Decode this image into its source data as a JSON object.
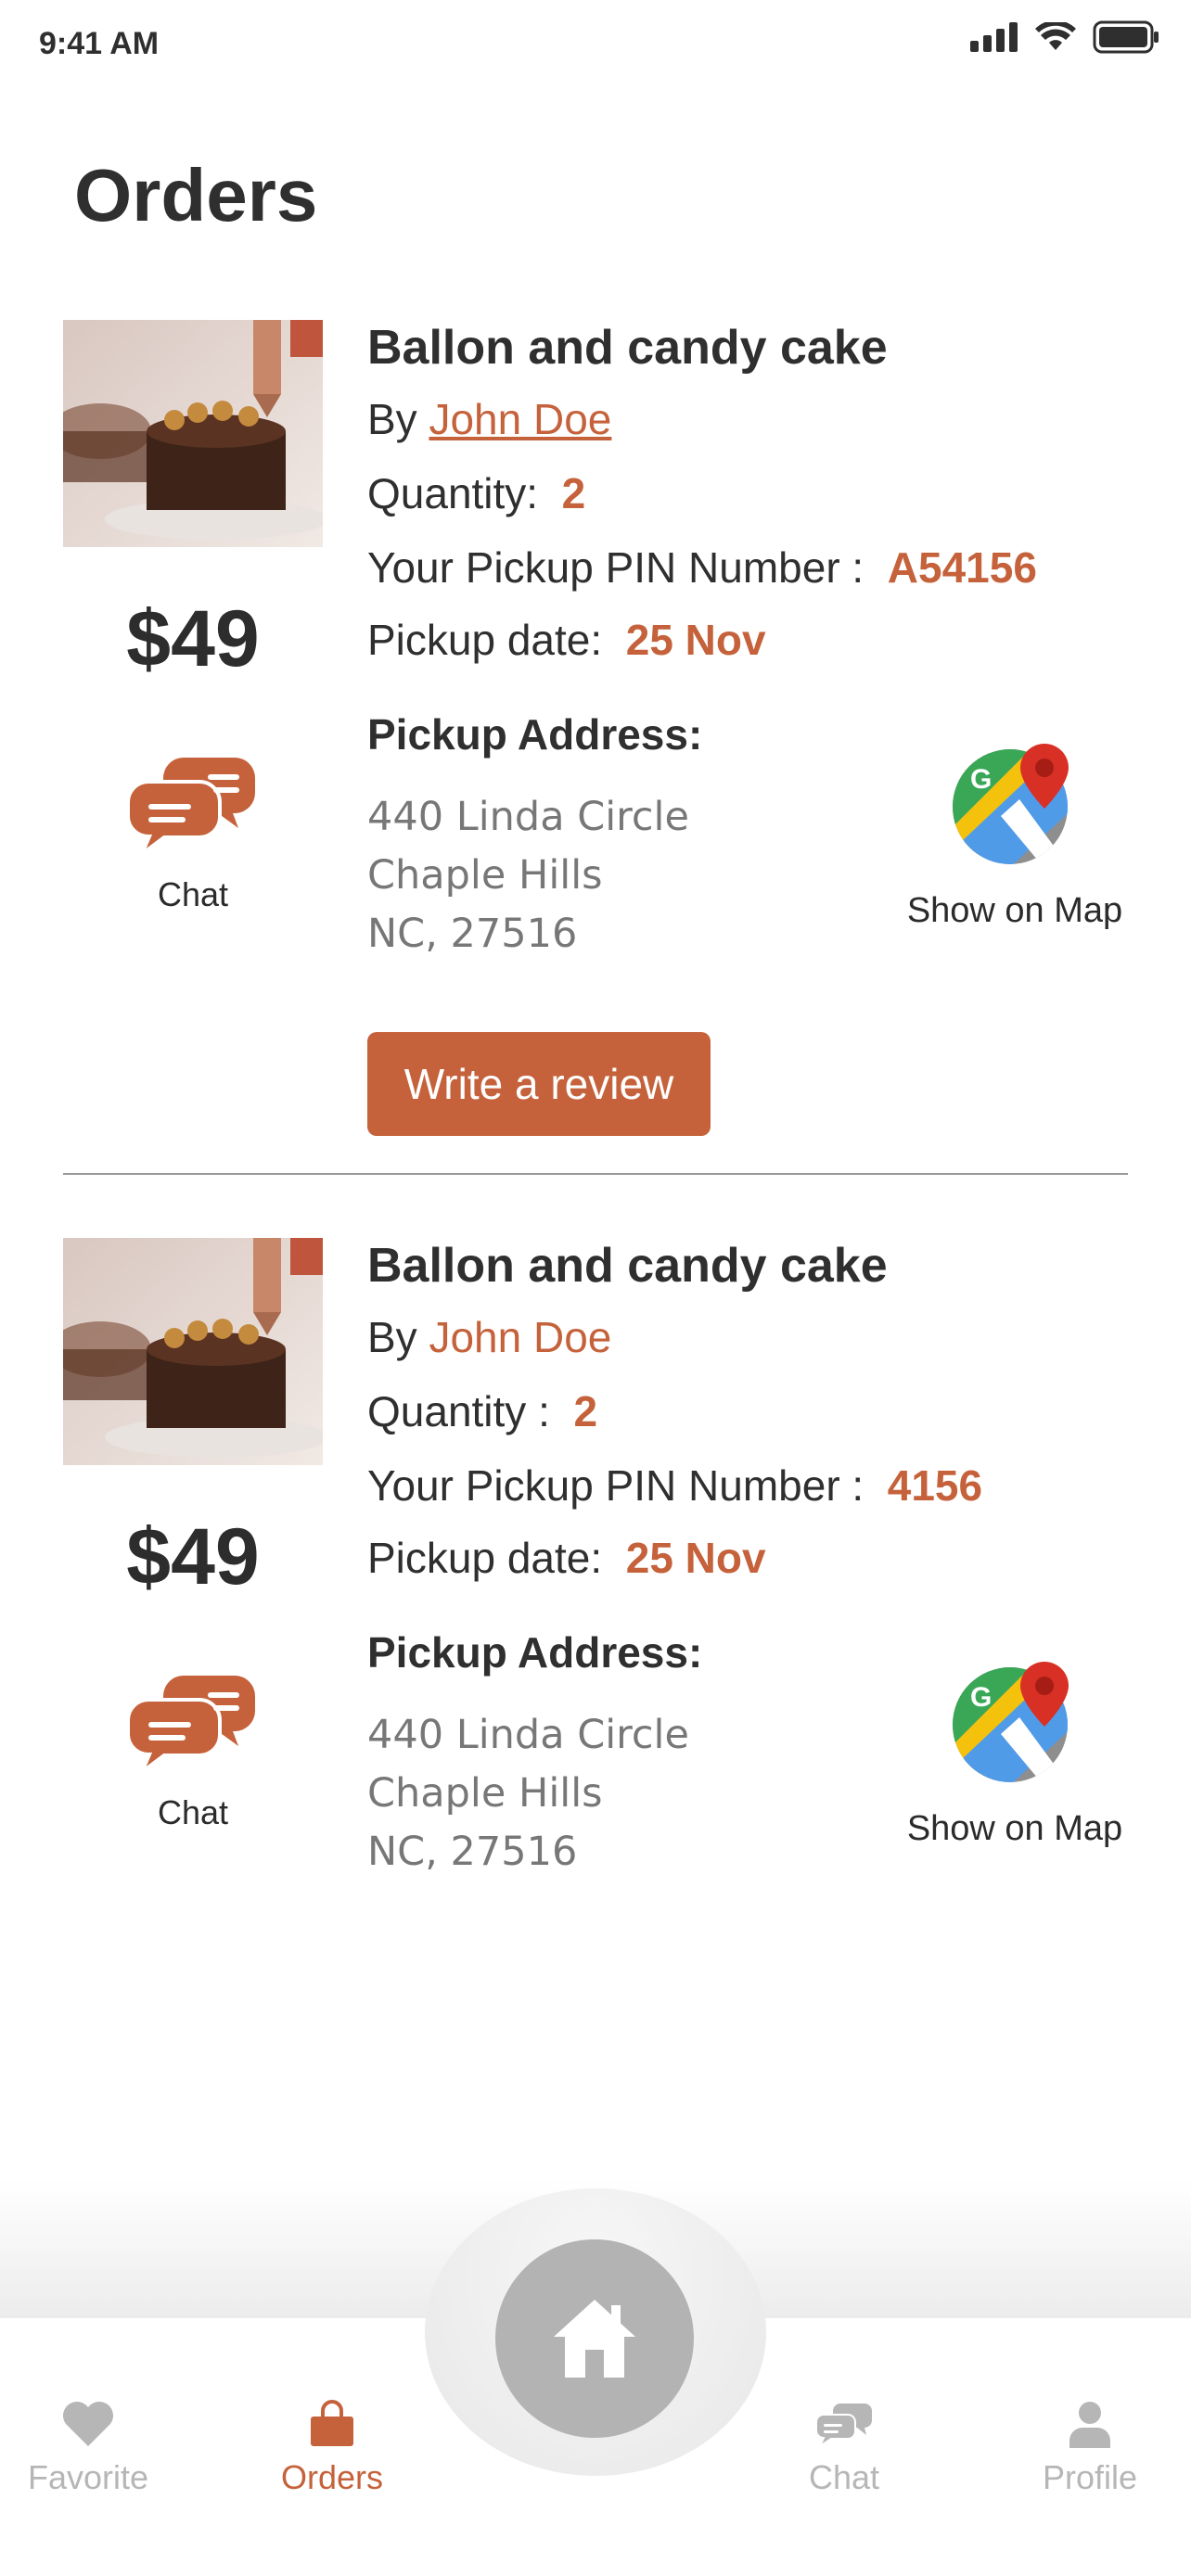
{
  "status_bar": {
    "time": "9:41 AM"
  },
  "page": {
    "title": "Orders"
  },
  "orders": [
    {
      "title": "Ballon and candy cake",
      "by_label": "By",
      "seller": "John Doe",
      "quantity_label": "Quantity:",
      "quantity": "2",
      "pin_label": "Your Pickup PIN Number :",
      "pin": "A54156",
      "date_label": "Pickup date:",
      "date": "25 Nov",
      "price": "$49",
      "chat_label": "Chat",
      "address_title": "Pickup Address:",
      "address_lines": [
        "440 Linda Circle",
        "Chaple Hills",
        "NC, 27516"
      ],
      "map_label": "Show on Map",
      "review_label": "Write a review"
    },
    {
      "title": "Ballon and candy cake",
      "by_label": "By",
      "seller": "John Doe",
      "quantity_label": "Quantity :",
      "quantity": "2",
      "pin_label": "Your Pickup PIN Number :",
      "pin": "4156",
      "date_label": "Pickup date:",
      "date": "25 Nov",
      "price": "$49",
      "chat_label": "Chat",
      "address_title": "Pickup Address:",
      "address_lines": [
        "440 Linda Circle",
        "Chaple Hills",
        "NC, 27516"
      ],
      "map_label": "Show on Map"
    }
  ],
  "tab_bar": {
    "items": [
      {
        "label": "Favorite",
        "icon": "heart-icon",
        "active": false
      },
      {
        "label": "Orders",
        "icon": "shopping-bag-icon",
        "active": true
      },
      {
        "label": "Chat",
        "icon": "chat-bubbles-icon",
        "active": false
      },
      {
        "label": "Profile",
        "icon": "person-icon",
        "active": false
      }
    ],
    "home_icon": "home-icon"
  },
  "colors": {
    "accent": "#C5623B",
    "text": "#2f2f2f",
    "muted": "#777777",
    "tab_inactive": "#b6b6b6",
    "home_button": "#b3b3b3"
  }
}
